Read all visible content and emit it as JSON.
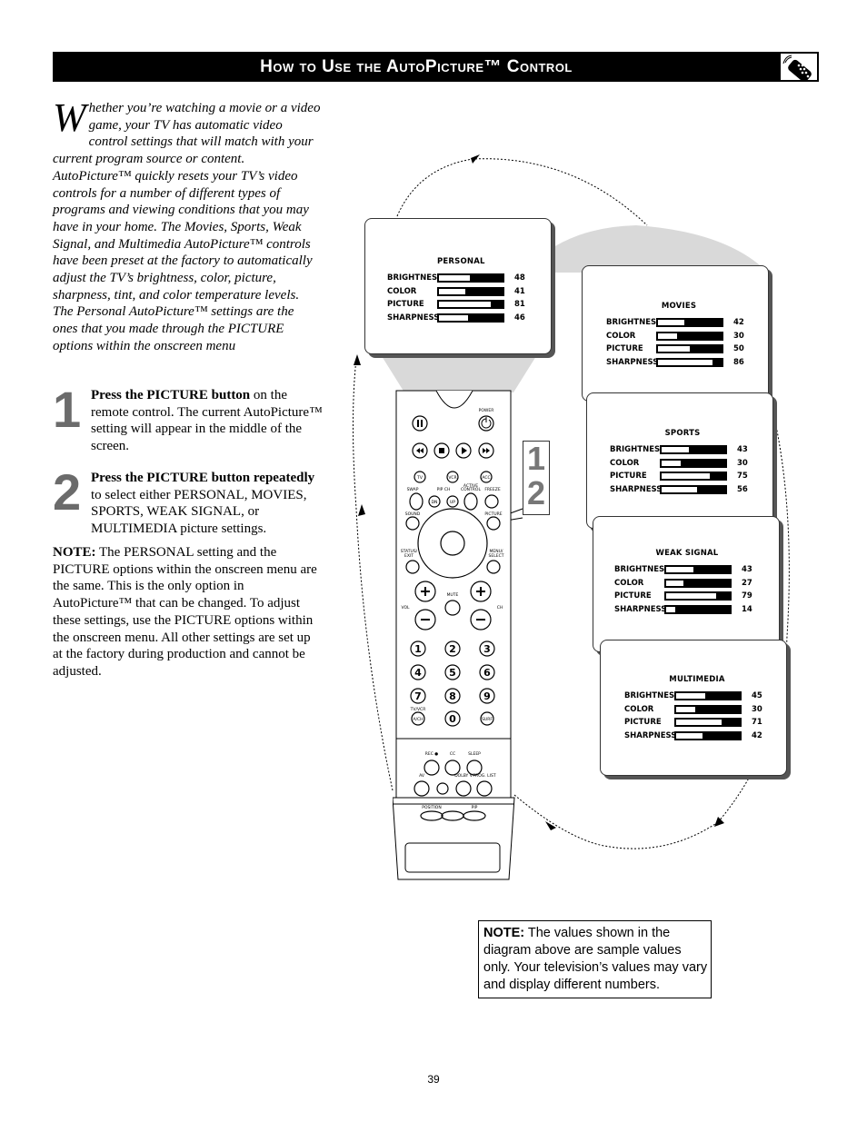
{
  "header": {
    "title": "How to Use the AutoPicture™ Control",
    "icon": "remote-control-icon"
  },
  "intro": {
    "dropcap": "W",
    "text": "hether you’re watching a movie or a video game, your TV has automatic video control settings that will match with your current program source or content. AutoPicture™ quickly resets your TV’s video controls for a number of different types of programs and viewing conditions that you may have in your home.  The Movies, Sports, Weak Signal, and Multimedia AutoPicture™ controls have been preset at the factory to automatically adjust the TV’s brightness, color, picture, sharpness, tint, and color temperature levels.  The Personal AutoPicture™ settings are the ones that you made through the PICTURE options within the onscreen menu"
  },
  "steps": [
    {
      "number": "1",
      "bold": "Press the PICTURE button",
      "text": " on the remote control.  The current AutoPicture™ setting will appear in the middle of the screen."
    },
    {
      "number": "2",
      "bold": "Press the PICTURE button repeatedly",
      "text": " to select either PERSONAL, MOVIES, SPORTS, WEAK SIGNAL, or MULTIMEDIA picture settings."
    }
  ],
  "note_left": {
    "label": "NOTE:",
    "text": "  The PERSONAL setting and the PICTURE options within the onscreen menu are the same.  This is the only option in AutoPicture™ that can be changed.  To adjust these settings, use the PICTURE options within the onscreen menu.  All other settings are set up at the factory during production and cannot be adjusted."
  },
  "note_box": {
    "label": "NOTE:",
    "text": " The values shown in the diagram above are sample values only. Your television’s values may vary and display different numbers."
  },
  "callout_numbers": [
    "1",
    "2"
  ],
  "panels": [
    {
      "name": "PERSONAL",
      "rows": [
        {
          "label": "BRIGHTNESS",
          "value": 48
        },
        {
          "label": "COLOR",
          "value": 41
        },
        {
          "label": "PICTURE",
          "value": 81
        },
        {
          "label": "SHARPNESS",
          "value": 46
        }
      ]
    },
    {
      "name": "MOVIES",
      "rows": [
        {
          "label": "BRIGHTNESS",
          "value": 42
        },
        {
          "label": "COLOR",
          "value": 30
        },
        {
          "label": "PICTURE",
          "value": 50
        },
        {
          "label": "SHARPNESS",
          "value": 86
        }
      ]
    },
    {
      "name": "SPORTS",
      "rows": [
        {
          "label": "BRIGHTNESS",
          "value": 43
        },
        {
          "label": "COLOR",
          "value": 30
        },
        {
          "label": "PICTURE",
          "value": 75
        },
        {
          "label": "SHARPNESS",
          "value": 56
        }
      ]
    },
    {
      "name": "WEAK  SIGNAL",
      "rows": [
        {
          "label": "BRIGHTNESS",
          "value": 43
        },
        {
          "label": "COLOR",
          "value": 27
        },
        {
          "label": "PICTURE",
          "value": 79
        },
        {
          "label": "SHARPNESS",
          "value": 14
        }
      ]
    },
    {
      "name": "MULTIMEDIA",
      "rows": [
        {
          "label": "BRIGHTNESS",
          "value": 45
        },
        {
          "label": "COLOR",
          "value": 30
        },
        {
          "label": "PICTURE",
          "value": 71
        },
        {
          "label": "SHARPNESS",
          "value": 42
        }
      ]
    }
  ],
  "remote": {
    "labels": {
      "power": "POWER",
      "tv": "TV",
      "vcr": "VCR",
      "acc": "ACC",
      "swap": "SWAP",
      "pip_ch": "PIP CH",
      "active_control": "ACTIVE CONTROL",
      "freeze": "FREEZE",
      "dn": "DN",
      "up": "UP",
      "sound": "SOUND",
      "picture": "PICTURE",
      "status_exit": "STATUS/ EXIT",
      "menu_select": "MENU/ SELECT",
      "mute": "MUTE",
      "vol": "VOL",
      "ch": "CH",
      "tv_vcr": "TV/VCR",
      "ach": "A/CH",
      "surf": "SURF",
      "rec": "REC ●",
      "cc": "CC",
      "sleep": "SLEEP",
      "av": "AV",
      "dolby": "DOLBY V",
      "prog_list": "PROG. LIST",
      "position": "POSITION",
      "pip": "PIP"
    },
    "digits": [
      "1",
      "2",
      "3",
      "4",
      "5",
      "6",
      "7",
      "8",
      "9",
      "0"
    ]
  },
  "page_number": "39"
}
